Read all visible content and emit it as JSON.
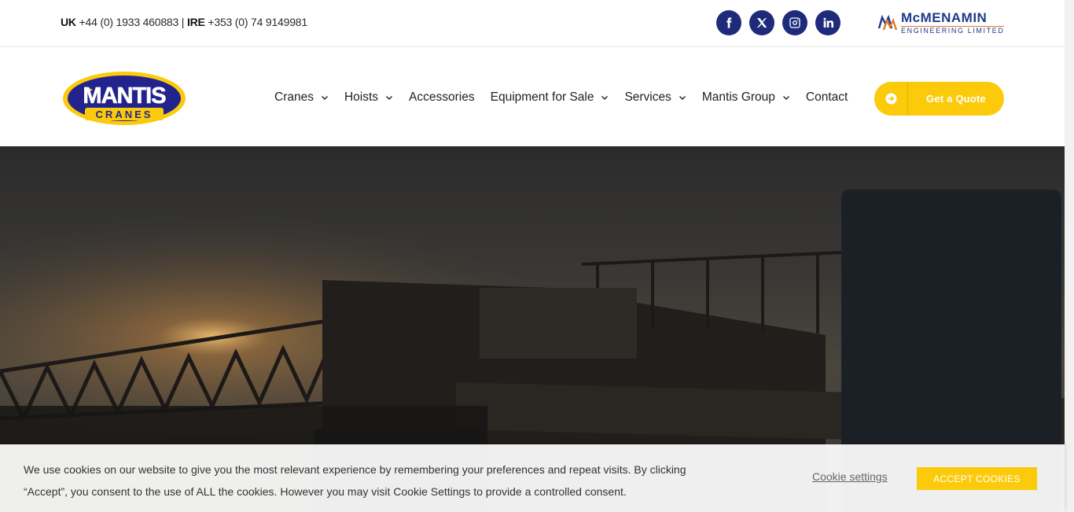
{
  "topbar": {
    "uk_label": "UK",
    "uk_phone": " +44 (0) 1933 460883 | ",
    "ire_label": "IRE",
    "ire_phone": " +353 (0) 74 9149981",
    "socials": [
      "facebook-icon",
      "x-twitter-icon",
      "instagram-icon",
      "linkedin-icon"
    ],
    "partner_logo": {
      "line1": "McMENAMIN",
      "line2": "ENGINEERING LIMITED"
    }
  },
  "header": {
    "logo": {
      "word": "MANTIS",
      "sub": "CRANES"
    },
    "nav": [
      {
        "label": "Cranes",
        "has_dropdown": true
      },
      {
        "label": "Hoists",
        "has_dropdown": true
      },
      {
        "label": "Accessories",
        "has_dropdown": false
      },
      {
        "label": "Equipment for Sale",
        "has_dropdown": true
      },
      {
        "label": "Services",
        "has_dropdown": true
      },
      {
        "label": "Mantis Group",
        "has_dropdown": true
      },
      {
        "label": "Contact",
        "has_dropdown": false
      }
    ],
    "quote_button": "Get a Quote"
  },
  "cookie": {
    "message": "We use cookies on our website to give you the most relevant experience by remembering your preferences and repeat visits. By clicking “Accept”, you consent to the use of ALL the cookies. However you may visit Cookie Settings to provide a controlled consent.",
    "settings_label": "Cookie settings",
    "accept_label": "ACCEPT COOKIES"
  },
  "colors": {
    "brand_navy": "#1e2b7a",
    "brand_yellow": "#fbcb0b"
  }
}
